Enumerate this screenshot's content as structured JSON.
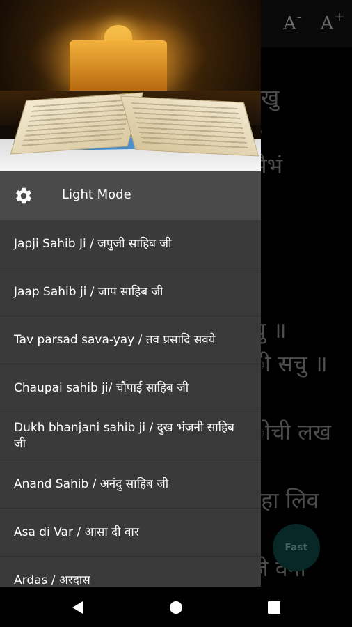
{
  "toolbar": {
    "font_decrease": "A",
    "font_decrease_sign": "-",
    "font_increase": "A",
    "font_increase_sign": "+"
  },
  "background_text": [
    "रखु",
    "ऽ",
    "सैभं",
    "चु ॥",
    "ी सचु ॥",
    "ोची लख",
    "रहा लिव",
    "जे वना"
  ],
  "fast_button": {
    "label": "Fast"
  },
  "drawer": {
    "mode_label": "Light Mode",
    "menu_items": [
      "Japji Sahib Ji / जपुजी साहिब जी",
      "Jaap Sahib ji / जाप साहिब जी",
      "Tav parsad sava-yay / तव प्रसादि सवये",
      "Chaupai sahib ji/ चौपाई साहिब जी",
      "Dukh bhanjani sahib ji / दुख भंजनी साहिब जी",
      "Anand Sahib / अनंदु साहिब जी",
      "Asa di Var / आसा दी वार",
      "Ardas / अरदास"
    ]
  },
  "colors": {
    "drawer_bg": "#3a3a3a",
    "mode_row_bg": "#4a4a4a",
    "fast_button_bg": "#0e4a45"
  }
}
